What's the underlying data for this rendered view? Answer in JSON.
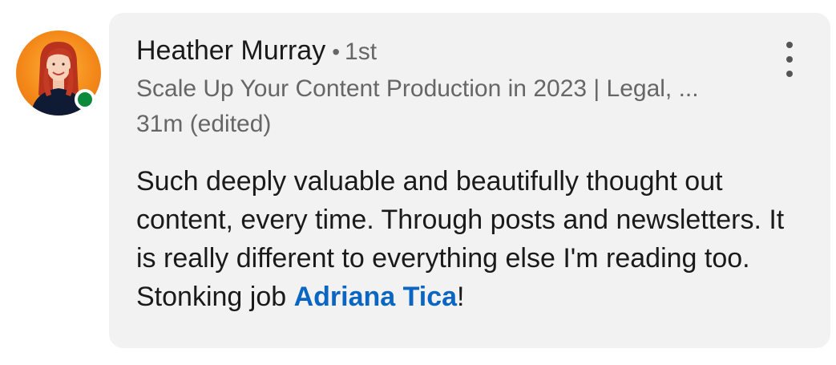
{
  "author": {
    "name": "Heather Murray",
    "separator": "•",
    "connection_degree": "1st",
    "headline": "Scale Up Your Content Production in 2023 | Legal, ...",
    "timestamp": "31m (edited)",
    "presence_status": "online",
    "presence_color": "#0a8a3a"
  },
  "comment": {
    "text_before_mention": "Such deeply valuable and beautifully thought out content, every time. Through posts and newsletters. It is really different to everything else I'm reading too. Stonking job ",
    "mention": "Adriana Tica",
    "text_after_mention": "!"
  },
  "icons": {
    "more": "more-vertical-icon",
    "avatar": "profile-photo"
  },
  "colors": {
    "bubble_background": "#f2f2f2",
    "mention_link": "#0a66c2",
    "secondary_text": "#666666",
    "primary_text": "#1a1a1a"
  }
}
